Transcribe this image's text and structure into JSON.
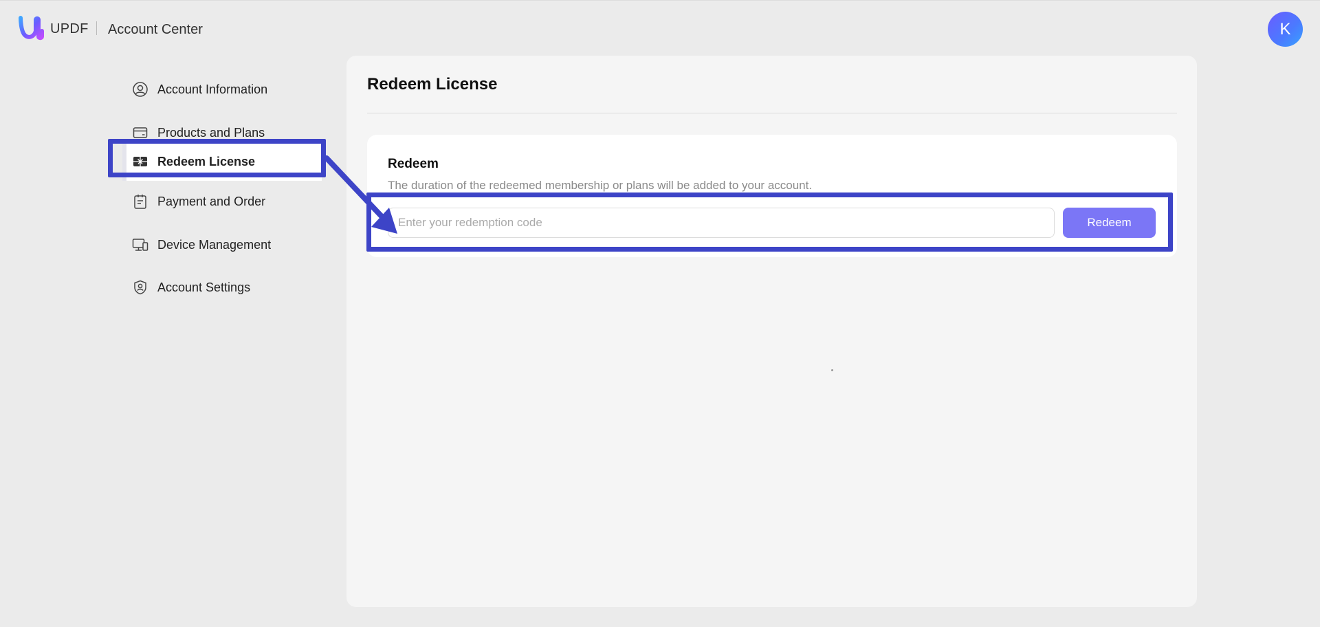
{
  "header": {
    "brand": "UPDF",
    "section": "Account Center",
    "avatar_initial": "K"
  },
  "sidebar": {
    "items": [
      {
        "label": "Account Information",
        "icon": "user-circle-icon"
      },
      {
        "label": "Products and Plans",
        "icon": "card-icon"
      },
      {
        "label": "Redeem License",
        "icon": "gift-card-icon",
        "active": true
      },
      {
        "label": "Payment and Order",
        "icon": "clipboard-icon"
      },
      {
        "label": "Device Management",
        "icon": "devices-icon"
      },
      {
        "label": "Account Settings",
        "icon": "shield-user-icon"
      }
    ]
  },
  "main": {
    "title": "Redeem License",
    "card": {
      "title": "Redeem",
      "description": "The duration of the redeemed membership or plans will be added to your account.",
      "input_placeholder": "Enter your redemption code",
      "input_value": "",
      "button_label": "Redeem"
    }
  },
  "colors": {
    "accent": "#7b76f6",
    "annotation": "#3d44c7",
    "background": "#ebebeb",
    "panel": "#f5f5f5"
  }
}
